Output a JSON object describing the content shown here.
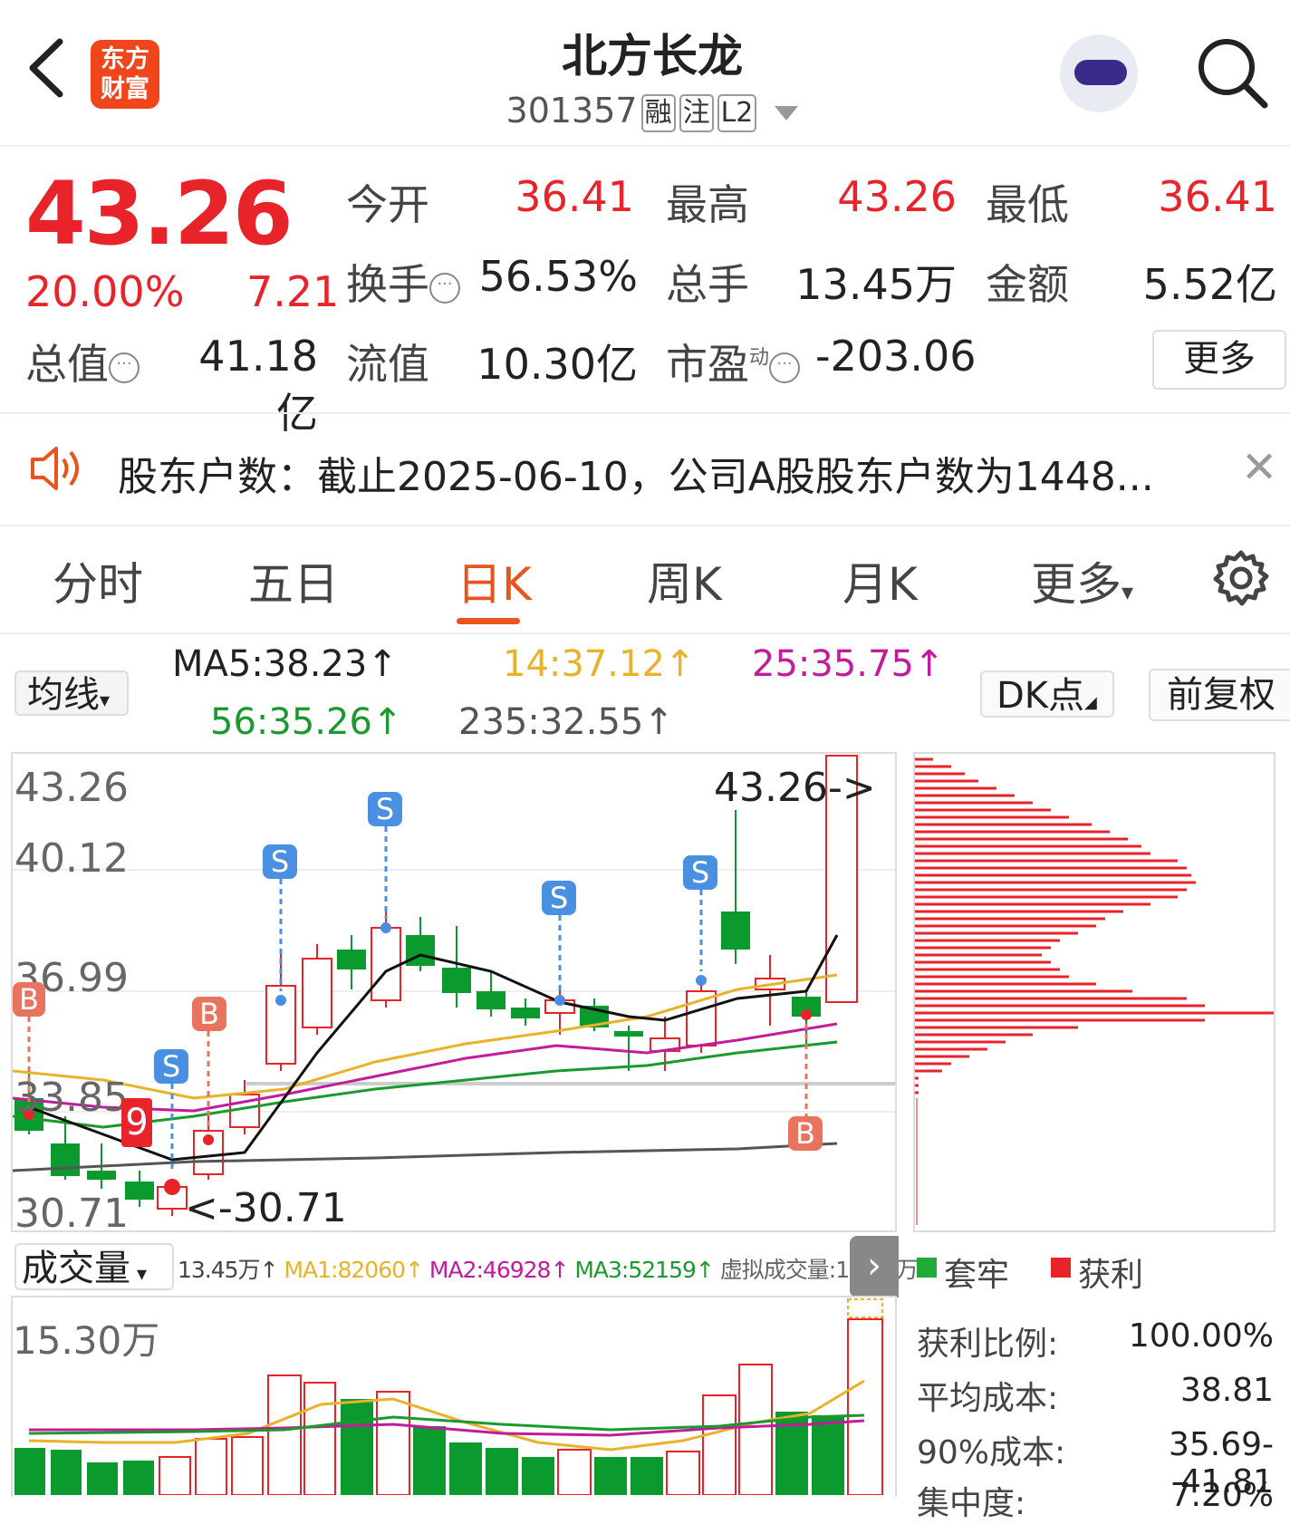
{
  "header": {
    "back_icon": "chevron-left-icon",
    "logo_line1": "东方",
    "logo_line2": "财富",
    "title": "北方长龙",
    "code": "301357",
    "tags": [
      "融",
      "注",
      "L2"
    ],
    "search_icon": "search-icon"
  },
  "quote": {
    "price": "43.26",
    "change_pct": "20.00%",
    "change": "7.21",
    "stats": [
      {
        "label": "今开",
        "value": "36.41",
        "color": "#e8232a"
      },
      {
        "label": "最高",
        "value": "43.26",
        "color": "#e8232a"
      },
      {
        "label": "最低",
        "value": "36.41",
        "color": "#e8232a"
      },
      {
        "label": "换手",
        "value": "56.53%",
        "color": "#222222"
      },
      {
        "label": "总手",
        "value": "13.45万",
        "color": "#222222"
      },
      {
        "label": "金额",
        "value": "5.52亿",
        "color": "#222222"
      },
      {
        "label": "总值",
        "value": "41.18亿",
        "color": "#222222"
      },
      {
        "label": "流值",
        "value": "10.30亿",
        "color": "#222222"
      },
      {
        "label": "市盈",
        "value": "-203.06",
        "color": "#222222"
      }
    ],
    "pe_superscript": "动",
    "more_label": "更多"
  },
  "notice": {
    "text": "股东户数：截止2025-06-10，公司A股股东户数为1448...",
    "close_icon": "close-icon"
  },
  "tabs": [
    "分时",
    "五日",
    "日K",
    "周K",
    "月K",
    "更多"
  ],
  "active_tab": "日K",
  "ma_bar": {
    "selector": "均线",
    "ma5": "MA5:38.23↑",
    "ma14": "14:37.12↑",
    "ma25": "25:35.75↑",
    "ma56": "56:35.26↑",
    "ma235": "235:32.55↑",
    "dk": "DK点",
    "adjust": "前复权"
  },
  "kchart": {
    "y_labels": [
      "43.26",
      "40.12",
      "36.99",
      "33.85",
      "30.71"
    ],
    "high_label": "43.26->",
    "low_label": "<-30.71",
    "nine_label": "9",
    "signal_s": "S",
    "signal_b": "B"
  },
  "volume_bar": {
    "selector": "成交量",
    "vol": "13.45万↑",
    "ma1": "MA1:82060↑",
    "ma2": "MA2:46928↑",
    "ma3": "MA3:52159↑",
    "virtual": "虚拟成交量:15.30万",
    "y_label": "15.30万"
  },
  "dist": {
    "legend_loss": "套牢",
    "legend_profit": "获利",
    "rows": [
      {
        "label": "获利比例:",
        "value": "100.00%"
      },
      {
        "label": "平均成本:",
        "value": "38.81"
      },
      {
        "label": "90%成本:",
        "value": "35.69-41.81"
      },
      {
        "label": "集中度:",
        "value": "7.20%"
      }
    ]
  },
  "colors": {
    "up": "#e8232a",
    "down": "#0b9a2e",
    "accent": "#e8541c",
    "ma5": "#111111",
    "ma14": "#e8b22a",
    "ma25": "#c21b9b",
    "ma56": "#1a9a2e"
  }
}
